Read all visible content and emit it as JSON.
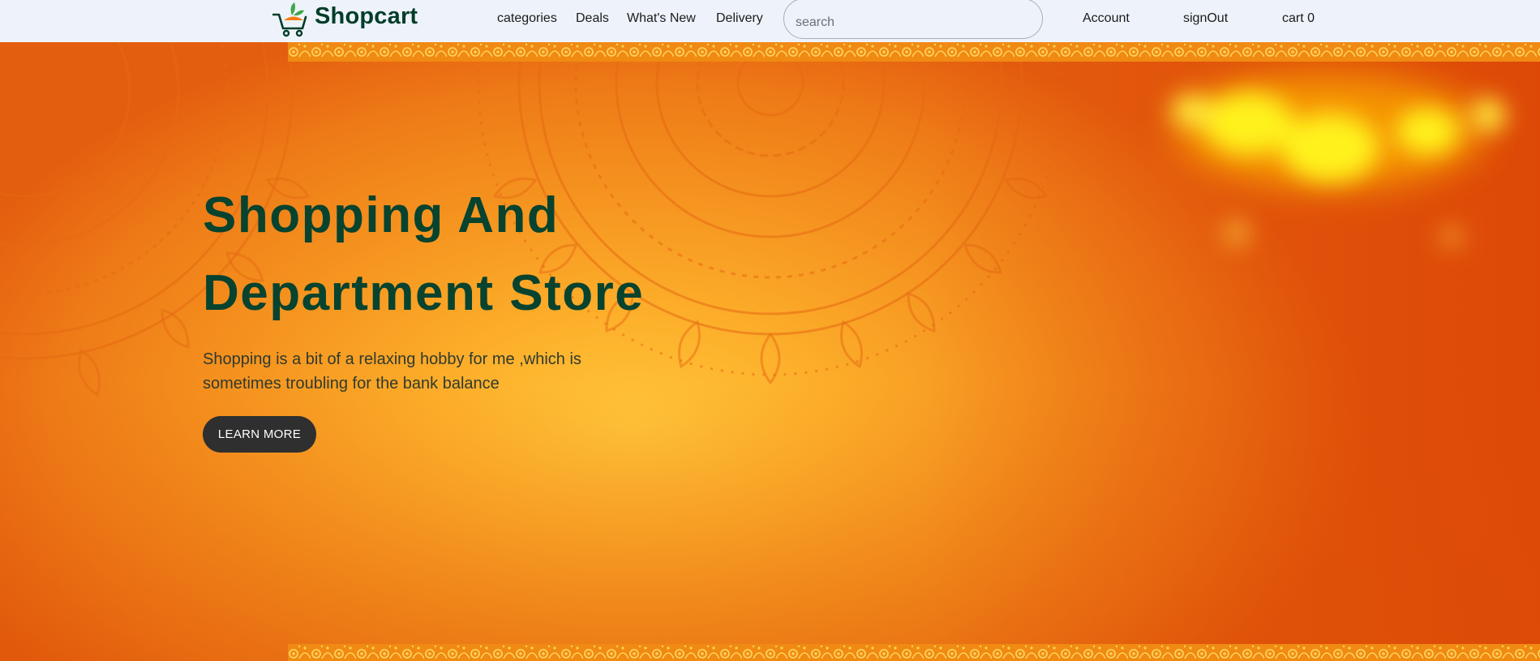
{
  "brand": {
    "name": "Shopcart",
    "logo_icon": "cart-icon"
  },
  "nav": {
    "links": [
      {
        "label": "categories"
      },
      {
        "label": "Deals"
      },
      {
        "label": "What's New"
      },
      {
        "label": "Delivery"
      }
    ],
    "search_placeholder": "search",
    "account_label": "Account",
    "signout_label": "signOut",
    "cart_label": "cart 0"
  },
  "hero": {
    "title_line1": "Shopping And",
    "title_line2": "Department Store",
    "text_line1": "Shopping is a bit of a relaxing hobby for me ,which is",
    "text_line2": "sometimes troubling for the bank balance",
    "button_label": "LEARN MORE"
  },
  "colors": {
    "brand_green": "#003d29",
    "nav_background": "#eef3fb",
    "hero_orange": "#f5931f",
    "button_dark": "#2f2f2f"
  }
}
